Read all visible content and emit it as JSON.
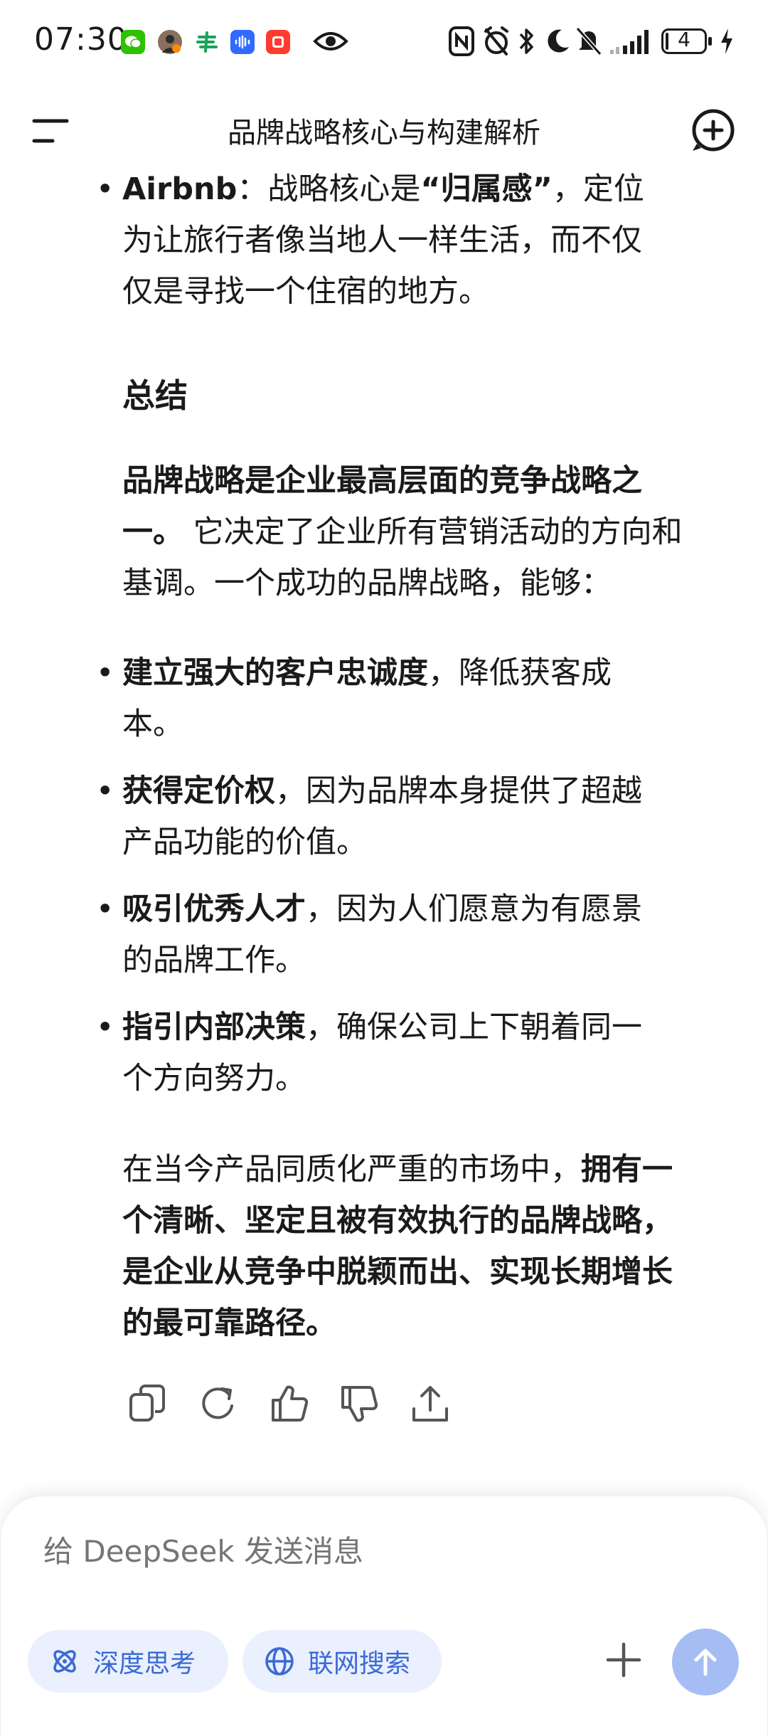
{
  "status_bar": {
    "time": "07:30",
    "battery": "4",
    "icons": [
      "wechat-icon",
      "avatar-icon",
      "wallet-icon",
      "voice-app-icon",
      "red-app-icon",
      "eye-icon",
      "nfc-icon",
      "alarm-off-icon",
      "bluetooth-icon",
      "moon-icon",
      "mute-icon",
      "signal-icon",
      "battery-icon",
      "charging-icon"
    ]
  },
  "header": {
    "title": "品牌战略核心与构建解析"
  },
  "content": {
    "airbnb": {
      "name": "Airbnb",
      "sep": "：战略核心是",
      "quote": "“归属感”",
      "rest_line1": "，定位",
      "line2": "为让旅行者像当地人一样生活，而不仅",
      "line3": "仅是寻找一个住宿的地方。"
    },
    "summary_heading": "总结",
    "intro": {
      "bold_line1": "品牌战略是企业最高层面的竞争战略之",
      "bold_line2": "一。",
      "rest_line2": " 它决定了企业所有营销活动的方向和",
      "line3": "基调。一个成功的品牌战略，能够："
    },
    "bullets": [
      {
        "bold": "建立强大的客户忠诚度",
        "rest1": "，降低获客成",
        "line2": "本。"
      },
      {
        "bold": "获得定价权",
        "rest1": "，因为品牌本身提供了超越",
        "line2": "产品功能的价值。"
      },
      {
        "bold": "吸引优秀人才",
        "rest1": "，因为人们愿意为有愿景",
        "line2": "的品牌工作。"
      },
      {
        "bold": "指引内部决策",
        "rest1": "，确保公司上下朝着同一",
        "line2": "个方向努力。"
      }
    ],
    "conclusion": {
      "plain_line1": "在当今产品同质化严重的市场中，",
      "bold_line1": "拥有一",
      "bold_line2": "个清晰、坚定且被有效执行的品牌战略，",
      "bold_line3": "是企业从竞争中脱颖而出、实现长期增长",
      "bold_line4": "的最可靠路径。"
    }
  },
  "actions": [
    "copy-icon",
    "regenerate-icon",
    "thumbs-up-icon",
    "thumbs-down-icon",
    "share-icon"
  ],
  "composer": {
    "placeholder": "给 DeepSeek 发送消息",
    "deep_think_label": "深度思考",
    "web_search_label": "联网搜索"
  },
  "colors": {
    "accent": "#3b6ad6",
    "chip_bg": "#eaf0fd",
    "send_bg": "#a6bdf4",
    "text": "#1a1a1a",
    "muted": "#a8a8a8"
  }
}
